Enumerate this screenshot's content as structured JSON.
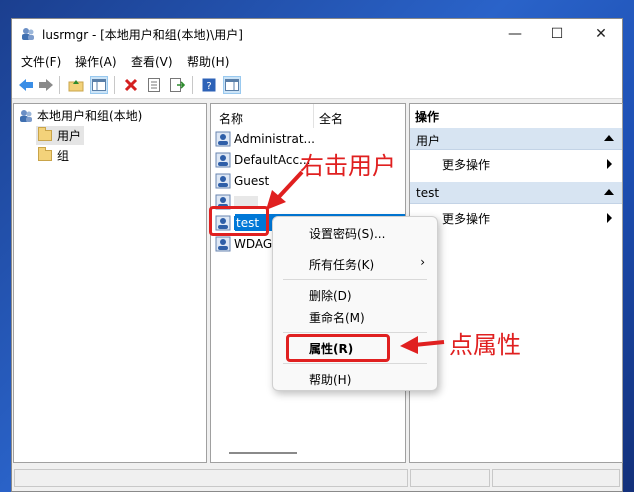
{
  "window": {
    "title": "lusrmgr - [本地用户和组(本地)\\用户]",
    "controls": {
      "minimize": "—",
      "maximize": "☐",
      "close": "✕"
    }
  },
  "menu": [
    "文件(F)",
    "操作(A)",
    "查看(V)",
    "帮助(H)"
  ],
  "tree": {
    "root": "本地用户和组(本地)",
    "children": [
      "用户",
      "组"
    ]
  },
  "list": {
    "columns": [
      "名称",
      "全名"
    ],
    "rows": [
      "Administrat...",
      "DefaultAcc...",
      "Guest",
      "",
      "test",
      "WDAG"
    ]
  },
  "actions": {
    "sections": [
      {
        "title": "用户",
        "item": "更多操作"
      },
      {
        "title": "test",
        "item": "更多操作"
      }
    ],
    "header": "操作"
  },
  "context_menu": {
    "items": [
      "设置密码(S)...",
      "所有任务(K)",
      "删除(D)",
      "重命名(M)",
      "属性(R)",
      "帮助(H)"
    ],
    "submenu_arrow": "›"
  },
  "annotations": {
    "right_click": "右击用户",
    "properties": "点属性"
  },
  "colors": {
    "selection": "#0078d7",
    "annotation": "#e02020"
  }
}
